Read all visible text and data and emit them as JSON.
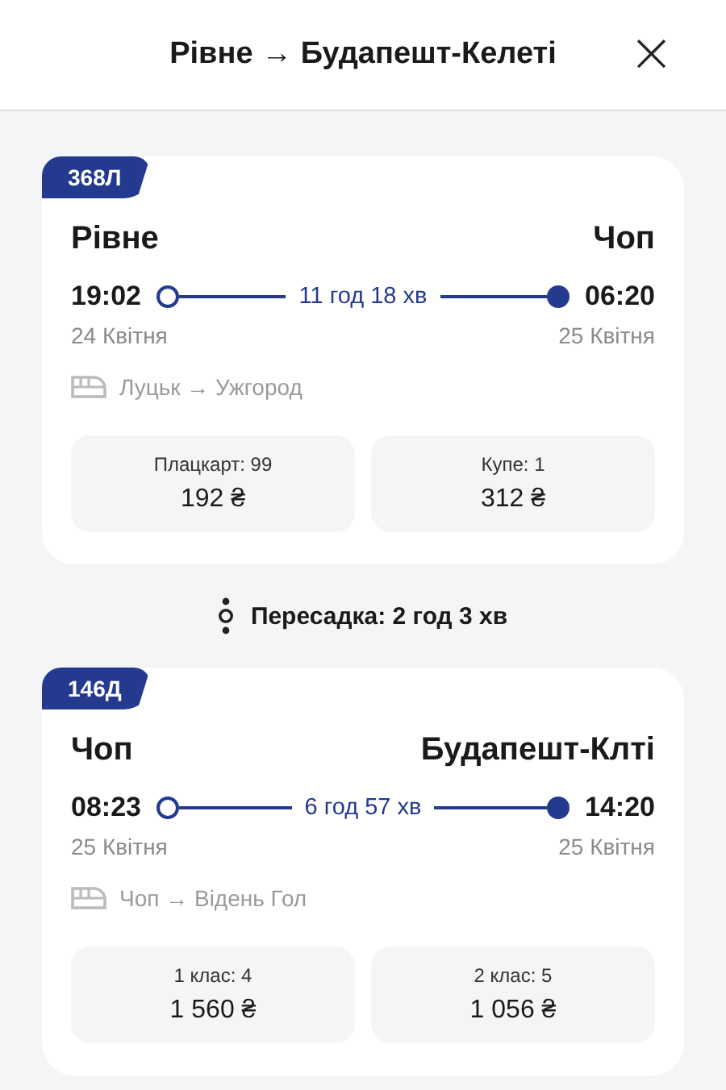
{
  "header": {
    "title": "Рівне → Будапешт-Келеті",
    "close": "×"
  },
  "segments": [
    {
      "train": "368Л",
      "from": "Рівне",
      "to": "Чоп",
      "departure": "19:02",
      "arrival": "06:20",
      "duration": "11 год 18 хв",
      "departure_date": "24 Квітня",
      "arrival_date": "25 Квітня",
      "route": "Луцьк → Ужгород",
      "fares": [
        {
          "class": "Плацкарт: 99",
          "price": "192 ₴"
        },
        {
          "class": "Купе: 1",
          "price": "312 ₴"
        }
      ]
    },
    {
      "train": "146Д",
      "from": "Чоп",
      "to": "Будапешт-Клті",
      "departure": "08:23",
      "arrival": "14:20",
      "duration": "6 год 57 хв",
      "departure_date": "25 Квітня",
      "arrival_date": "25 Квітня",
      "route": "Чоп → Відень Гол",
      "fares": [
        {
          "class": "1 клас: 4",
          "price": "1 560 ₴"
        },
        {
          "class": "2 клас: 5",
          "price": "1 056 ₴"
        }
      ]
    }
  ],
  "transfers": [
    "Пересадка: 2 год 3 хв"
  ]
}
